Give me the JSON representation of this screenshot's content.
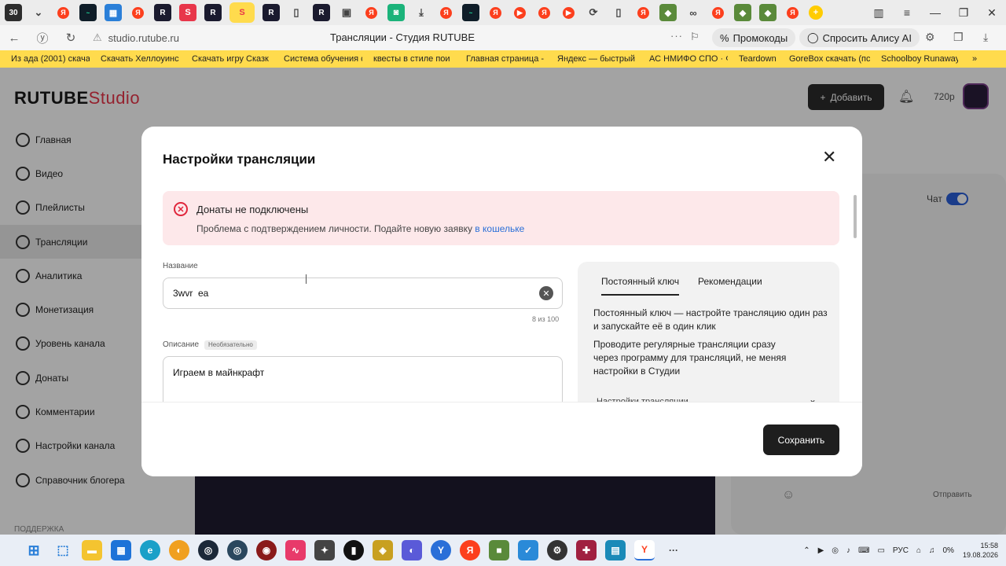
{
  "browser": {
    "tab_count": "30",
    "url": "studio.rutube.ru",
    "title": "Трансляции - Студия RUTUBE",
    "promo_label": "Промокоды",
    "alice_label": "Спросить Алису AI",
    "bookmarks": [
      "Из ада (2001) скача",
      "Скачать Хеллоуинс",
      "Скачать игру Сказк",
      "Система обучения с",
      "квесты в стиле пои",
      "Главная страница -",
      "Яндекс — быстрый",
      "АС НМИФО СПО · Ф",
      "Teardown",
      "GoreBox скачать (пс",
      "Schoolboy Runaway"
    ]
  },
  "page": {
    "logo": "RUTUBE",
    "logo_studio": "Studio",
    "add_button": "Добавить",
    "quality": "720p",
    "chat_label": "Чат",
    "send_label": "Отправить",
    "support_label": "ПОДДЕРЖКА",
    "sidebar": [
      {
        "label": "Главная"
      },
      {
        "label": "Видео"
      },
      {
        "label": "Плейлисты"
      },
      {
        "label": "Трансляции"
      },
      {
        "label": "Аналитика"
      },
      {
        "label": "Монетизация"
      },
      {
        "label": "Уровень канала"
      },
      {
        "label": "Донаты"
      },
      {
        "label": "Комментарии"
      },
      {
        "label": "Настройки канала"
      },
      {
        "label": "Справочник блогера"
      }
    ]
  },
  "modal": {
    "title": "Настройки трансляции",
    "alert_title": "Донаты не подключены",
    "alert_text": "Проблема с подтверждением личности. Подайте новую заявку",
    "alert_link": "в кошельке",
    "name_label": "Название",
    "name_value": "3wvr  ea",
    "name_counter": "8 из 100",
    "desc_label": "Описание",
    "desc_badge": "Необязательно",
    "desc_value": "Играем в майнкрафт",
    "tab_key": "Постоянный ключ",
    "tab_reco": "Рекомендации",
    "key_text_1": "Постоянный ключ — настройте трансляцию один раз и запускайте её в один клик",
    "key_text_2": "Проводите регулярные трансляции сразу через программу для трансляций, не меняя настройки в Студии",
    "key_collapsed": "Настройки трансляции",
    "save_button": "Сохранить"
  },
  "taskbar": {
    "lang": "РУС",
    "battery": "0%",
    "time": "15:58",
    "date": "19.08.2026"
  }
}
